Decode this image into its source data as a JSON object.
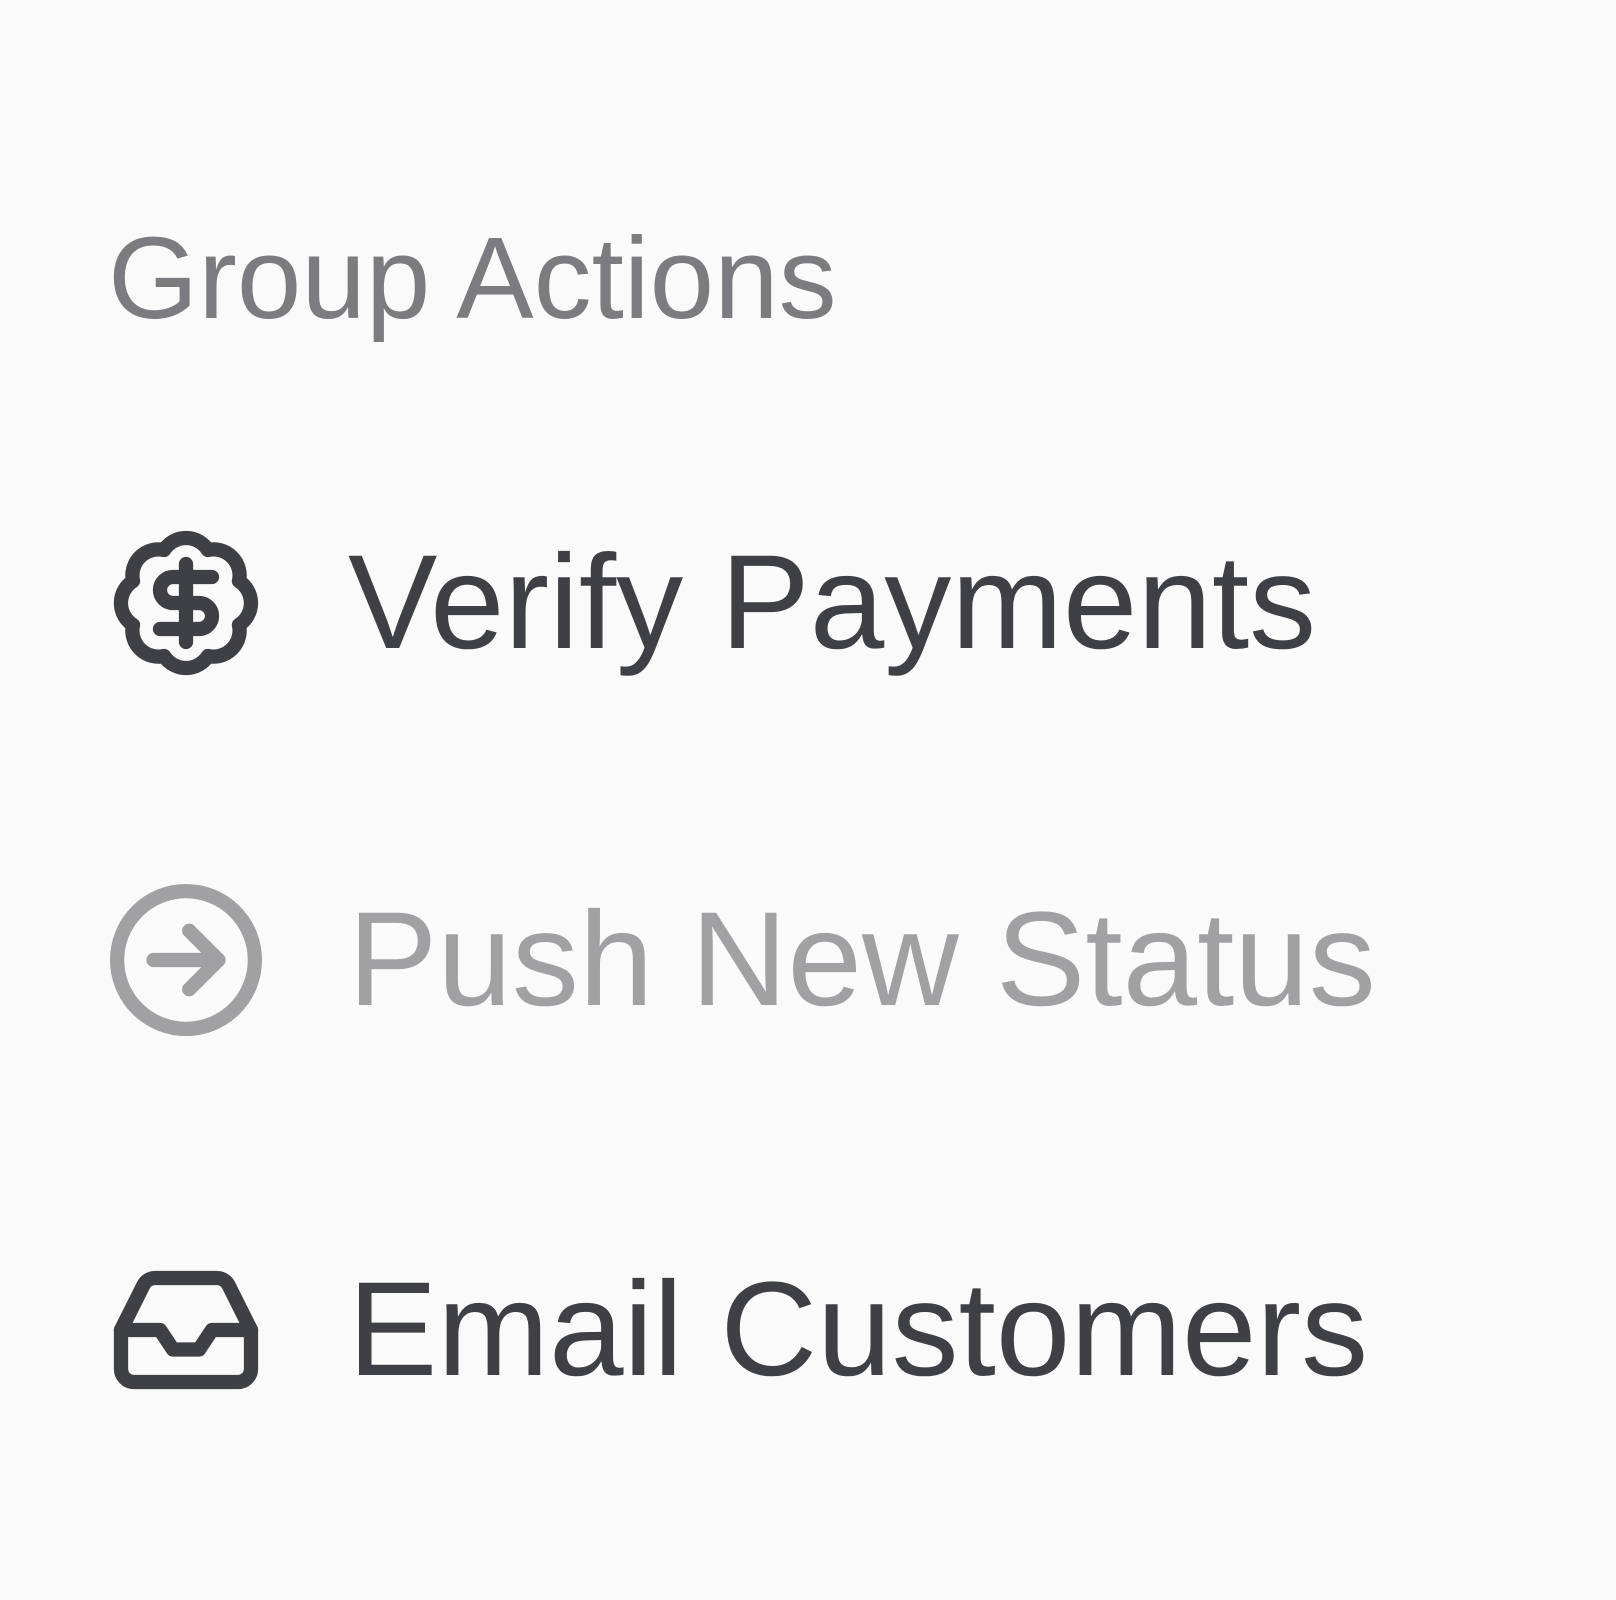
{
  "menu": {
    "title": "Group Actions",
    "items": [
      {
        "label": "Verify Payments",
        "icon": "badge-dollar-icon",
        "enabled": true
      },
      {
        "label": "Push New Status",
        "icon": "circle-arrow-right-icon",
        "enabled": false
      },
      {
        "label": "Email Customers",
        "icon": "inbox-icon",
        "enabled": true
      }
    ]
  },
  "colors": {
    "background": "#fafafa",
    "title": "#7b7b80",
    "enabled_text": "#3f3f46",
    "disabled_text": "#a1a1a4"
  }
}
